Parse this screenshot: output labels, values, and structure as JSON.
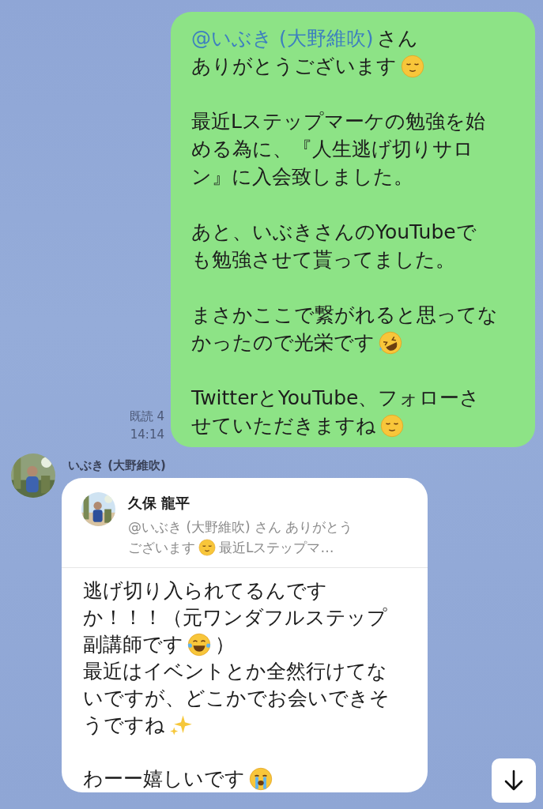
{
  "outgoing": {
    "read_receipt": "既読 4",
    "time": "14:14",
    "paragraphs": [
      [
        [
          {
            "kind": "mention",
            "text": "@いぶき (大野維吹)"
          },
          {
            "kind": "text",
            "text": "さん"
          }
        ],
        [
          {
            "kind": "text",
            "text": "ありがとうございます"
          },
          {
            "kind": "relieved"
          }
        ]
      ],
      [
        [
          {
            "kind": "text",
            "text": "最近Lステップマーケの勉強を始"
          }
        ],
        [
          {
            "kind": "text",
            "text": "める為に、『人生逃げ切りサロ"
          }
        ],
        [
          {
            "kind": "text",
            "text": "ン』に入会致しました。"
          }
        ]
      ],
      [
        [
          {
            "kind": "text",
            "text": "あと、いぶきさんのYouTubeで"
          }
        ],
        [
          {
            "kind": "text",
            "text": "も勉強させて貰ってました。"
          }
        ]
      ],
      [
        [
          {
            "kind": "text",
            "text": "まさかここで繋がれると思ってな"
          }
        ],
        [
          {
            "kind": "text",
            "text": "かったので光栄です"
          },
          {
            "kind": "rofl"
          }
        ]
      ],
      [
        [
          {
            "kind": "text",
            "text": "TwitterとYouTube、フォローさ"
          }
        ],
        [
          {
            "kind": "text",
            "text": "せていただきますね"
          },
          {
            "kind": "relieved"
          }
        ]
      ]
    ]
  },
  "incoming": {
    "sender": "いぶき (大野維吹)",
    "quote": {
      "author": "久保 龍平",
      "preview_lines": [
        [
          {
            "kind": "text",
            "text": "@いぶき (大野維吹) さん ありがとう"
          }
        ],
        [
          {
            "kind": "text",
            "text": "ございます"
          },
          {
            "kind": "relieved"
          },
          {
            "kind": "text",
            "text": "最近Lステップマ…"
          }
        ]
      ]
    },
    "paragraphs": [
      [
        [
          {
            "kind": "text",
            "text": "逃げ切り入られてるんです"
          }
        ],
        [
          {
            "kind": "text",
            "text": "か！！！（元ワンダフルステップ"
          }
        ],
        [
          {
            "kind": "text",
            "text": "副講師です"
          },
          {
            "kind": "joy"
          },
          {
            "kind": "text",
            "text": "）"
          }
        ],
        [
          {
            "kind": "text",
            "text": "最近はイベントとか全然行けてな"
          }
        ],
        [
          {
            "kind": "text",
            "text": "いですが、どこかでお会いできそ"
          }
        ],
        [
          {
            "kind": "text",
            "text": "うですね"
          },
          {
            "kind": "sparkles"
          }
        ]
      ],
      [
        [
          {
            "kind": "text",
            "text": "わーー嬉しいです"
          },
          {
            "kind": "sob"
          }
        ]
      ]
    ]
  }
}
